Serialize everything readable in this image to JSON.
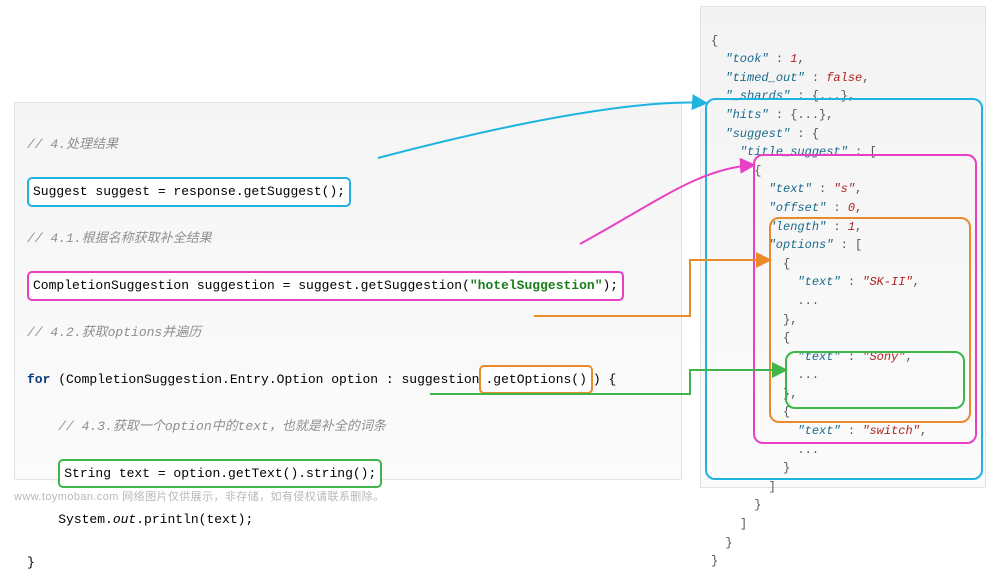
{
  "left_code": {
    "comment1": "// 4.处理结果",
    "line_suggest": "Suggest suggest = response.getSuggest();",
    "comment2": "// 4.1.根据名称获取补全结果",
    "line_suggestion_pre": "CompletionSuggestion suggestion = suggest.getSuggestion(",
    "line_suggestion_str": "\"hotelSuggestion\"",
    "line_suggestion_post": ");",
    "comment3": "// 4.2.获取options并遍历",
    "for_keyword": "for",
    "for_head": " (CompletionSuggestion.Entry.Option option : suggestion",
    "for_get_options": ".getOptions()",
    "for_tail": ") {",
    "comment4": "// 4.3.获取一个option中的text，也就是补全的词条",
    "line_text": "String text = option.getText().string();",
    "println_pre": "System.",
    "println_out": "out",
    "println_post": ".println(text);",
    "brace_close": "}"
  },
  "right_json": {
    "open": "{",
    "took_k": "\"took\"",
    "took_v": "1",
    "timedout_k": "\"timed_out\"",
    "timedout_v": "false",
    "shards_k": "\"_shards\"",
    "shards_v": "{...}",
    "hits_k": "\"hits\"",
    "hits_v": "{...}",
    "suggest_k": "\"suggest\"",
    "suggest_v": "{",
    "title_k": "\"title_suggest\"",
    "title_v": "[",
    "entry_open": "{",
    "text_k": "\"text\"",
    "text_v": "\"s\"",
    "offset_k": "\"offset\"",
    "offset_v": "0",
    "length_k": "\"length\"",
    "length_v": "1",
    "options_k": "\"options\"",
    "options_v": "[",
    "opt_open": "{",
    "opt1_text_k": "\"text\"",
    "opt1_text_v": "\"SK-II\"",
    "ellipsis": "...",
    "opt_close": "},",
    "opt2_text_k": "\"text\"",
    "opt2_text_v": "\"Sony\"",
    "opt3_open": "{",
    "opt3_text_k": "\"text\"",
    "opt3_text_v": "\"switch\"",
    "opt3_close": "}",
    "options_close": "]",
    "entry_close": "}",
    "title_close": "]",
    "suggest_close": "}",
    "close": "}"
  },
  "footer": "www.toymoban.com 网络图片仅供展示，非存储，如有侵权请联系删除。",
  "colors": {
    "cyan": "#1fb4e0",
    "magenta": "#e83fc4",
    "orange": "#e98a2b",
    "green": "#3fb54a"
  }
}
